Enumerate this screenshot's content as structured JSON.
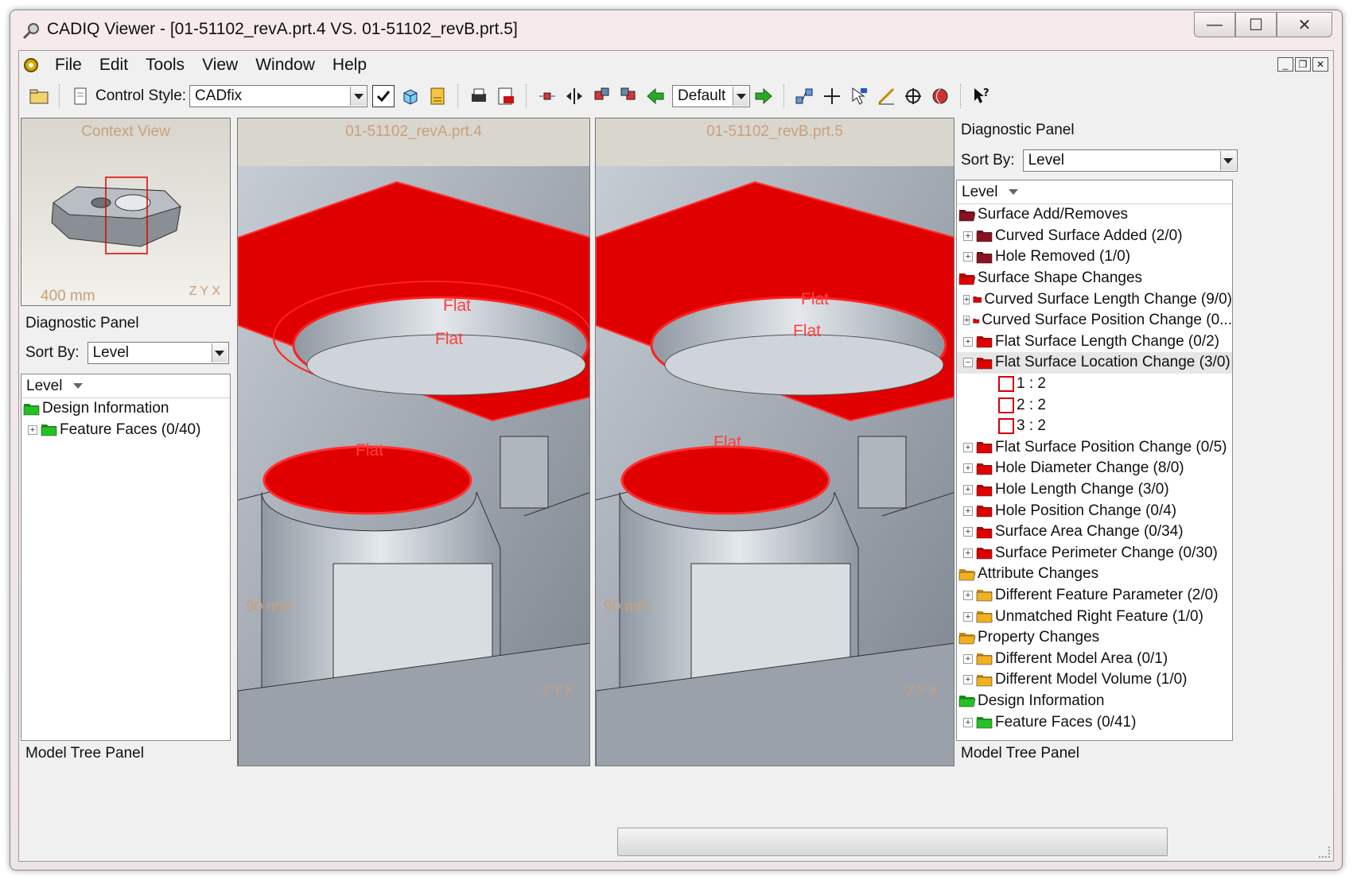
{
  "window": {
    "title": "CADIQ Viewer - [01-51102_revA.prt.4 VS. 01-51102_revB.prt.5]",
    "controls": {
      "minimize": "—",
      "maximize": "☐",
      "close": "✕"
    }
  },
  "menu": {
    "items": [
      "File",
      "Edit",
      "Tools",
      "View",
      "Window",
      "Help"
    ]
  },
  "toolbar": {
    "control_style_label": "Control Style:",
    "control_style_value": "CADfix",
    "view_mode_value": "Default"
  },
  "context_view": {
    "title": "Context View",
    "scale": "400 mm",
    "axes": "Z Y X"
  },
  "left_panel": {
    "diagnostic_title": "Diagnostic Panel",
    "sort_label": "Sort By:",
    "sort_value": "Level",
    "tree_header": "Level",
    "tree": [
      {
        "label": "Design Information",
        "level": 0,
        "color": "green"
      },
      {
        "label": "Feature Faces (0/40)",
        "level": 1,
        "color": "green"
      }
    ],
    "model_tree_title": "Model Tree Panel"
  },
  "viewport_a": {
    "title": "01-51102_revA.prt.4",
    "scale": "90 mm",
    "axes": "Z Y X",
    "labels": [
      "Flat",
      "Flat",
      "Flat"
    ]
  },
  "viewport_b": {
    "title": "01-51102_revB.prt.5",
    "scale": "90 mm",
    "axes": "Z Y X",
    "labels": [
      "Flat",
      "Flat",
      "Flat"
    ]
  },
  "right_panel": {
    "diagnostic_title": "Diagnostic Panel",
    "sort_label": "Sort By:",
    "sort_value": "Level",
    "tree_header": "Level",
    "tree": [
      {
        "label": "Surface Add/Removes",
        "level": 0,
        "color": "darkred",
        "open": true
      },
      {
        "label": "Curved Surface Added (2/0)",
        "level": 1,
        "color": "darkred"
      },
      {
        "label": "Hole Removed (1/0)",
        "level": 1,
        "color": "darkred"
      },
      {
        "label": "Surface Shape Changes",
        "level": 0,
        "color": "red",
        "open": true
      },
      {
        "label": "Curved Surface Length Change (9/0)",
        "level": 1,
        "color": "red"
      },
      {
        "label": "Curved Surface Position Change (0...",
        "level": 1,
        "color": "red"
      },
      {
        "label": "Flat Surface Length Change (0/2)",
        "level": 1,
        "color": "red"
      },
      {
        "label": "Flat Surface Location Change (3/0)",
        "level": 1,
        "color": "red",
        "expanded": true,
        "selected": true
      },
      {
        "label": "1 : 2",
        "level": 2,
        "color": "leaf"
      },
      {
        "label": "2 : 2",
        "level": 2,
        "color": "leaf"
      },
      {
        "label": "3 : 2",
        "level": 2,
        "color": "leaf"
      },
      {
        "label": "Flat Surface Position Change (0/5)",
        "level": 1,
        "color": "red"
      },
      {
        "label": "Hole Diameter Change (8/0)",
        "level": 1,
        "color": "red"
      },
      {
        "label": "Hole Length Change (3/0)",
        "level": 1,
        "color": "red"
      },
      {
        "label": "Hole Position Change (0/4)",
        "level": 1,
        "color": "red"
      },
      {
        "label": "Surface Area Change (0/34)",
        "level": 1,
        "color": "red"
      },
      {
        "label": "Surface Perimeter Change (0/30)",
        "level": 1,
        "color": "red"
      },
      {
        "label": "Attribute Changes",
        "level": 0,
        "color": "orange",
        "open": true
      },
      {
        "label": "Different Feature Parameter (2/0)",
        "level": 1,
        "color": "orange"
      },
      {
        "label": "Unmatched Right Feature (1/0)",
        "level": 1,
        "color": "orange"
      },
      {
        "label": "Property Changes",
        "level": 0,
        "color": "orange",
        "open": true
      },
      {
        "label": "Different Model Area (0/1)",
        "level": 1,
        "color": "orange"
      },
      {
        "label": "Different Model Volume (1/0)",
        "level": 1,
        "color": "orange"
      },
      {
        "label": "Design Information",
        "level": 0,
        "color": "green",
        "open": true
      },
      {
        "label": "Feature Faces (0/41)",
        "level": 1,
        "color": "green"
      }
    ],
    "model_tree_title": "Model Tree Panel"
  },
  "colors": {
    "highlight_red": "#e00000",
    "dark_red": "#8b1020",
    "folder_orange": "#f0b020",
    "folder_green": "#22c322",
    "annotation": "#c9a07b"
  }
}
